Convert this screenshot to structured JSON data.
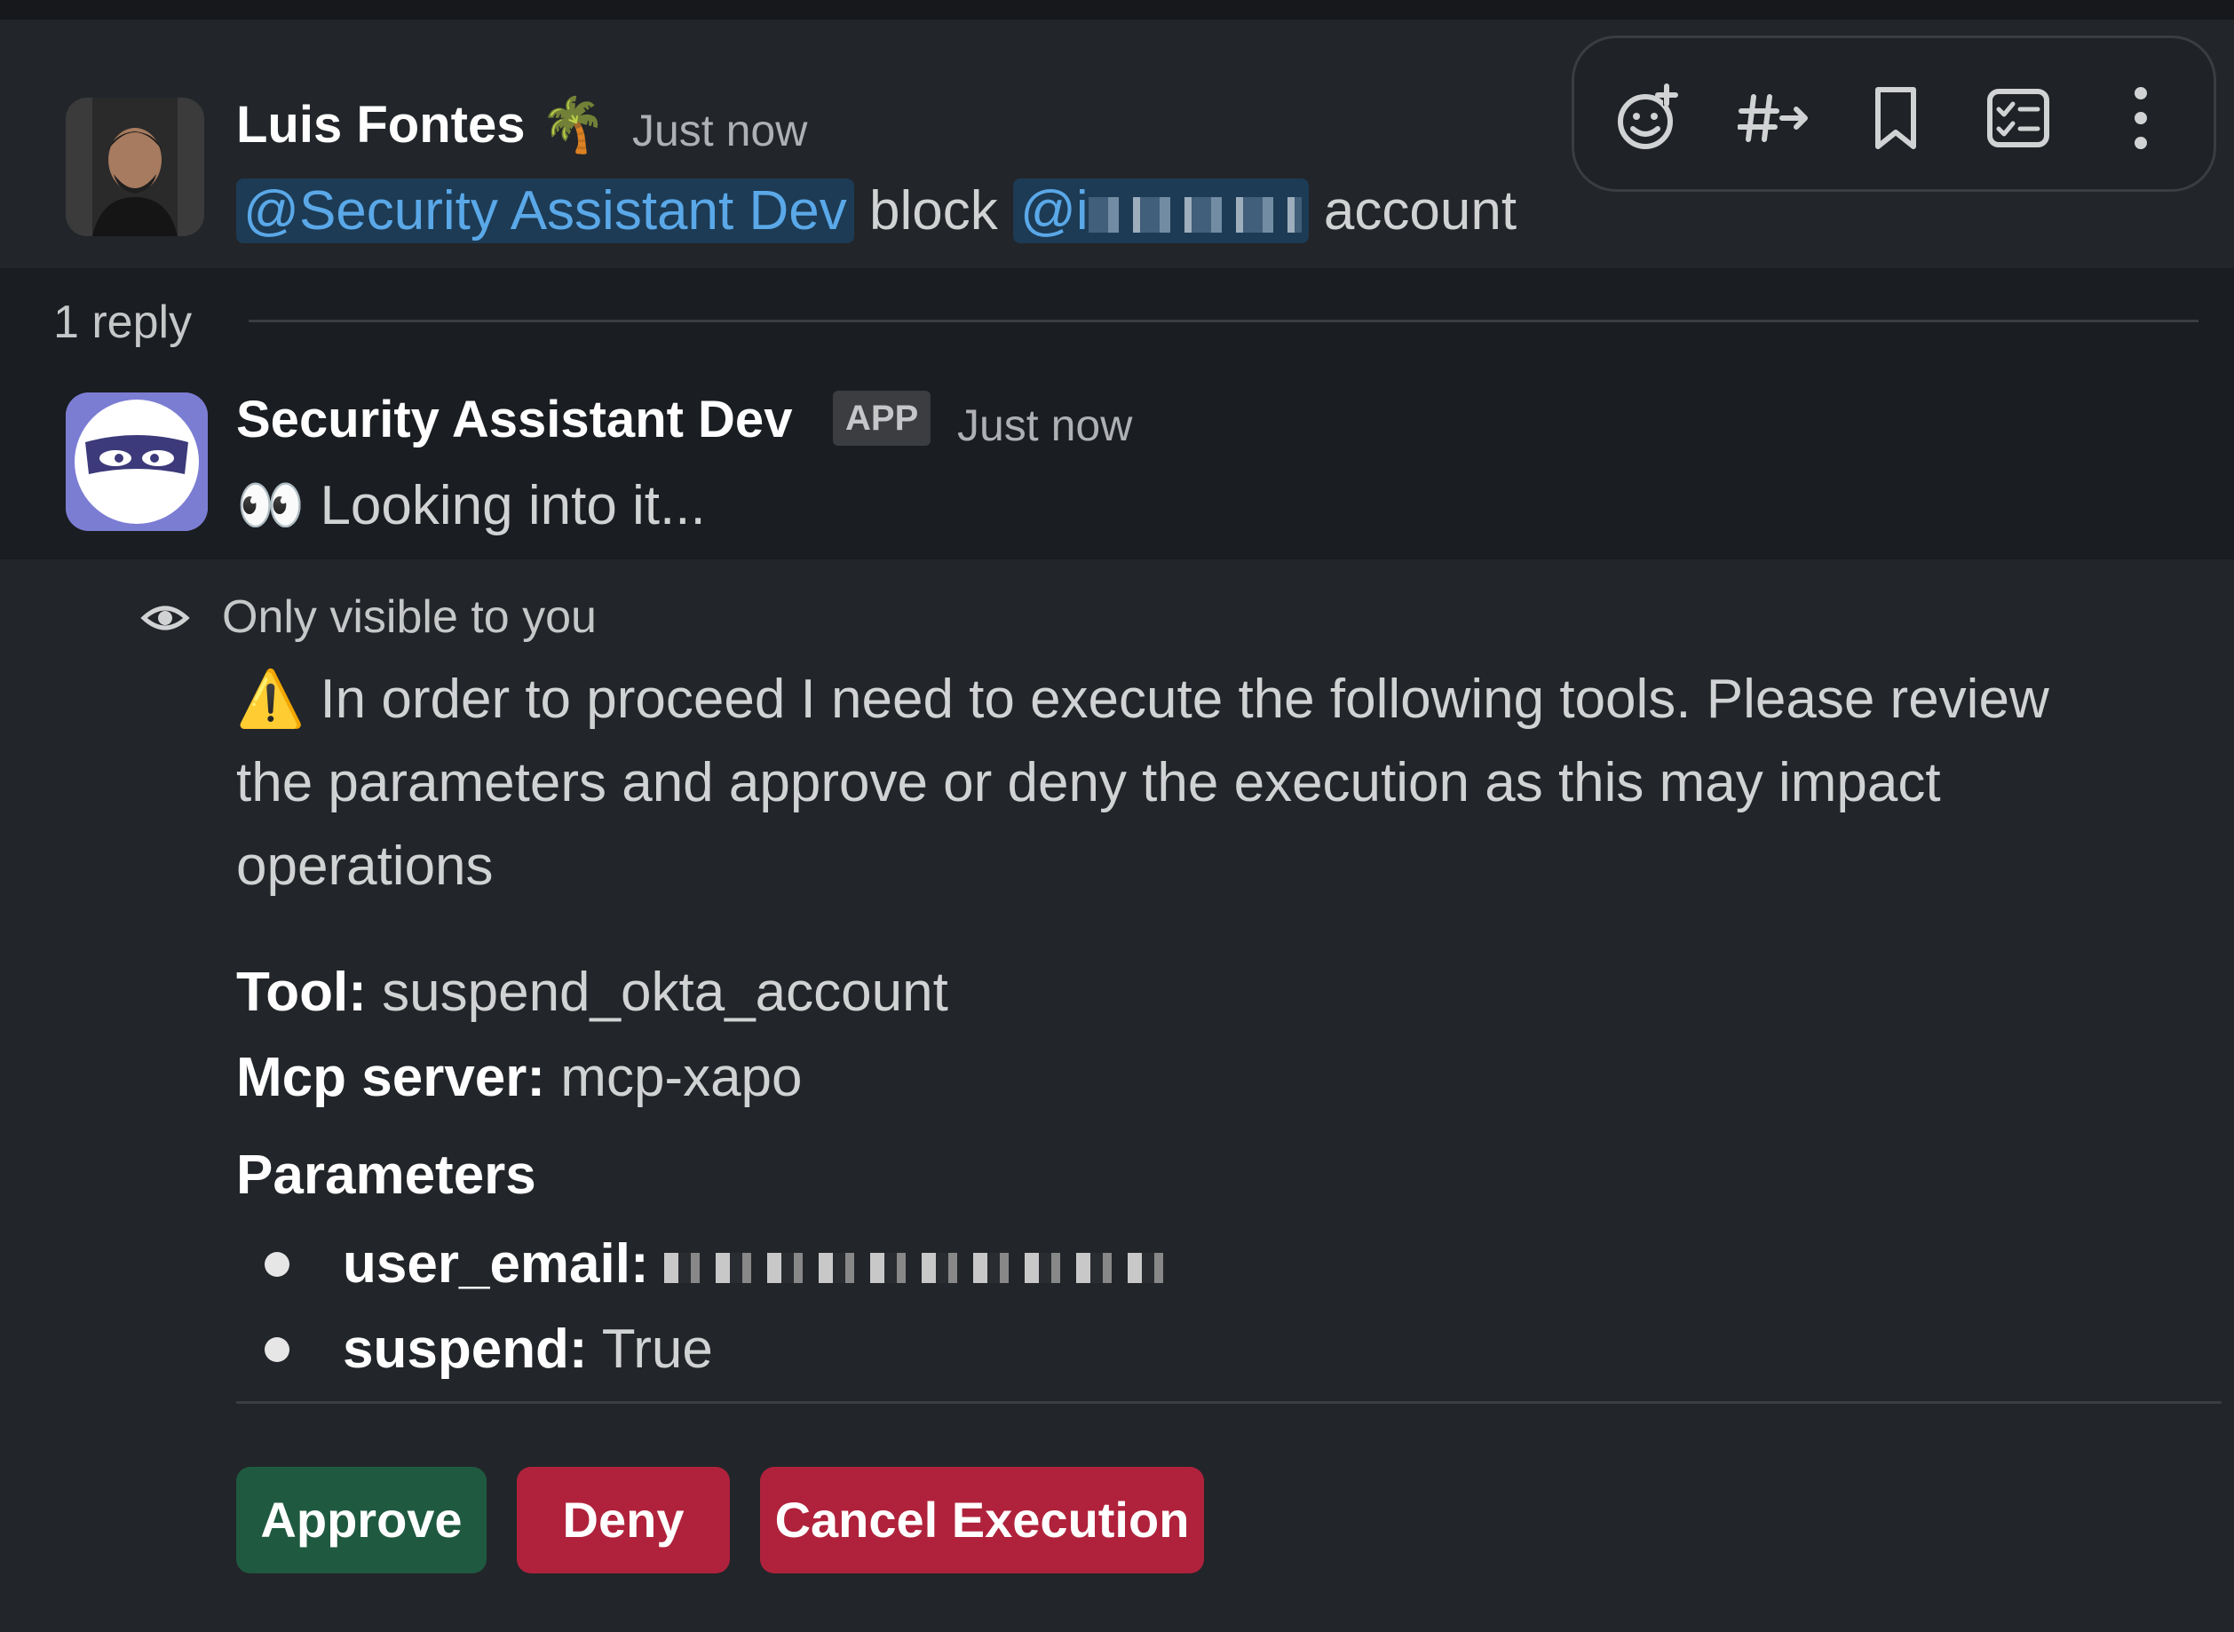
{
  "thread": {
    "parent": {
      "author": "Luis Fontes",
      "author_emoji": "🌴",
      "timestamp": "Just now",
      "mention_bot": "@Security Assistant Dev",
      "text_mid": "block",
      "mention_user_prefix": "@i",
      "text_end": "account"
    },
    "reply_count": "1 reply",
    "bot_reply": {
      "author": "Security Assistant Dev",
      "badge": "APP",
      "timestamp": "Just now",
      "emoji": "👀",
      "text": "Looking into it..."
    },
    "ephemeral": {
      "visibility": "Only visible to you",
      "warning_emoji": "⚠️",
      "line1": "In order to proceed I need to execute the following tools. Please review",
      "line2": "the parameters and approve or deny the execution as this may impact",
      "line3": "operations",
      "tool_label": "Tool:",
      "tool_value": "suspend_okta_account",
      "server_label": "Mcp server:",
      "server_value": "mcp-xapo",
      "params_heading": "Parameters",
      "params": [
        {
          "key": "user_email:",
          "value": ""
        },
        {
          "key": "suspend:",
          "value": "True"
        }
      ]
    },
    "actions": {
      "approve": "Approve",
      "deny": "Deny",
      "cancel": "Cancel Execution"
    }
  },
  "toolbar": {
    "icons": [
      "add-reaction-icon",
      "forward-to-channel-icon",
      "bookmark-icon",
      "create-task-icon",
      "more-actions-icon"
    ]
  },
  "colors": {
    "approve": "#1f5a40",
    "deny": "#b0223c",
    "mention_text": "#5aa8e8",
    "mention_bg": "#1d3b55"
  }
}
